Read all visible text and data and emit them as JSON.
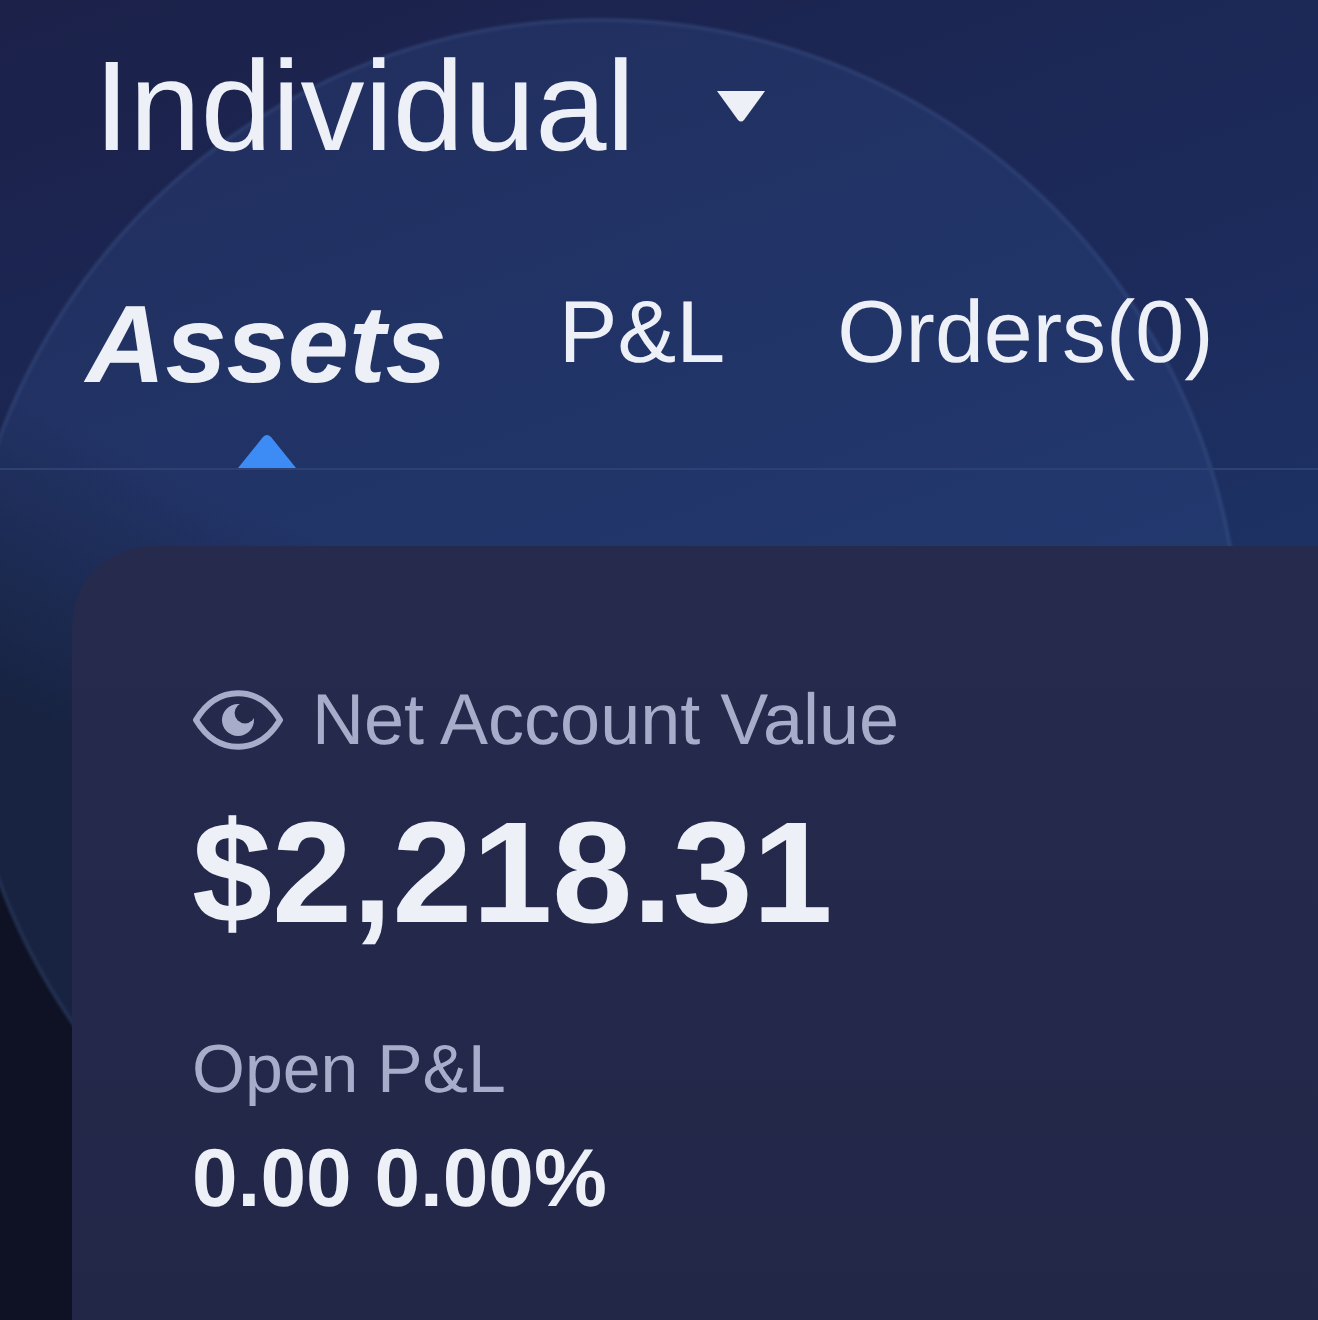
{
  "account": {
    "name": "Individual"
  },
  "tabs": [
    {
      "label": "Assets",
      "selected": true
    },
    {
      "label": "P&L",
      "selected": false
    },
    {
      "label": "Orders(0)",
      "selected": false
    }
  ],
  "summary": {
    "net_value_label": "Net Account Value",
    "net_value": "$2,218.31",
    "open_pnl_label": "Open P&L",
    "open_pnl": "0.00 0.00%"
  }
}
